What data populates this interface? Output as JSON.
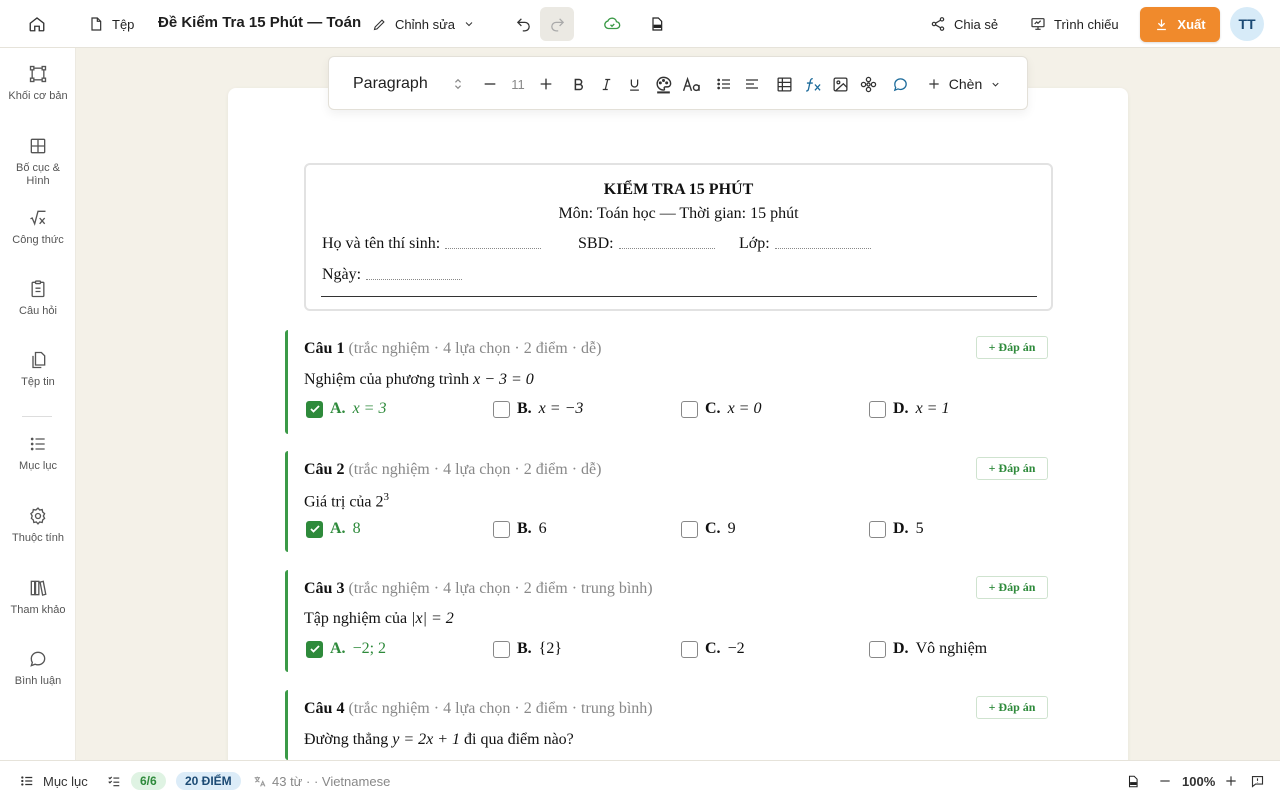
{
  "topbar": {
    "file_label": "Tệp",
    "doc_title": "Đề Kiểm Tra 15 Phút — Toán",
    "edit_label": "Chỉnh sửa",
    "share_label": "Chia sẻ",
    "present_label": "Trình chiếu",
    "export_label": "Xuất",
    "avatar_initials": "TT",
    "accent_color": "#f08a2c"
  },
  "sidebar": {
    "items": [
      {
        "label": "Khối cơ bản",
        "icon": "blocks-icon"
      },
      {
        "label": "Bố cục & Hình",
        "icon": "layout-icon"
      },
      {
        "label": "Công thức",
        "icon": "formula-icon"
      },
      {
        "label": "Câu hỏi",
        "icon": "clipboard-icon"
      },
      {
        "label": "Tệp tin",
        "icon": "files-icon"
      },
      {
        "label": "Mục lục",
        "icon": "list-icon"
      },
      {
        "label": "Thuộc tính",
        "icon": "gear-icon"
      },
      {
        "label": "Tham khảo",
        "icon": "books-icon"
      },
      {
        "label": "Bình luận",
        "icon": "comment-icon"
      }
    ]
  },
  "format_toolbar": {
    "style_value": "Paragraph",
    "font_size": "11",
    "insert_label": "Chèn"
  },
  "header": {
    "title": "KIỂM TRA 15 PHÚT",
    "subtitle": "Môn: Toán học — Thời gian: 15 phút",
    "name_label": "Họ và tên thí sinh:",
    "sbd_label": "SBD:",
    "class_label": "Lớp:",
    "date_label": "Ngày:"
  },
  "answer_button_label": "+ Đáp án",
  "questions": [
    {
      "label": "Câu 1",
      "meta": "(trắc nghiệm · 4 lựa chọn · 2 điểm · dễ)",
      "text": "Nghiệm của phương trình ",
      "math": "x − 3 = 0",
      "options": [
        {
          "letter": "A.",
          "value": "x = 3",
          "checked": true
        },
        {
          "letter": "B.",
          "value": "x = −3",
          "checked": false
        },
        {
          "letter": "C.",
          "value": "x = 0",
          "checked": false
        },
        {
          "letter": "D.",
          "value": "x = 1",
          "checked": false
        }
      ]
    },
    {
      "label": "Câu 2",
      "meta": "(trắc nghiệm · 4 lựa chọn · 2 điểm · dễ)",
      "text": "Giá trị của 2",
      "sup": "3",
      "options": [
        {
          "letter": "A.",
          "value": "8",
          "checked": true
        },
        {
          "letter": "B.",
          "value": "6",
          "checked": false
        },
        {
          "letter": "C.",
          "value": "9",
          "checked": false
        },
        {
          "letter": "D.",
          "value": "5",
          "checked": false
        }
      ]
    },
    {
      "label": "Câu 3",
      "meta": "(trắc nghiệm · 4 lựa chọn · 2 điểm · trung bình)",
      "text": "Tập nghiệm của ",
      "math": "|x| = 2",
      "options": [
        {
          "letter": "A.",
          "value": "−2; 2",
          "checked": true
        },
        {
          "letter": "B.",
          "value": "{2}",
          "checked": false
        },
        {
          "letter": "C.",
          "value": "−2",
          "checked": false
        },
        {
          "letter": "D.",
          "value": "Vô nghiệm",
          "checked": false
        }
      ]
    },
    {
      "label": "Câu 4",
      "meta": "(trắc nghiệm · 4 lựa chọn · 2 điểm · trung bình)",
      "text": "Đường thẳng ",
      "math": "y = 2x + 1",
      "text_after": " đi qua điểm nào?"
    }
  ],
  "statusbar": {
    "toc_label": "Mục lục",
    "progress_pill": "6/6",
    "points_pill": "20 ĐIỂM",
    "word_count": "43 từ · · Vietnamese",
    "zoom": "100%"
  }
}
